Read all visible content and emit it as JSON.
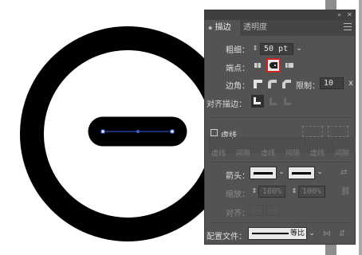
{
  "panel": {
    "tabs": {
      "stroke": "描边",
      "transparency": "透明度"
    },
    "weight": {
      "label": "粗细：",
      "value": "50 pt"
    },
    "cap": {
      "label": "端点："
    },
    "corner": {
      "label": "边角：",
      "limit_label": "限制：",
      "limit_value": "10",
      "limit_unit": "x"
    },
    "align": {
      "label": "对齐描边："
    },
    "dashed": {
      "label": "虚线"
    },
    "dash_cells": [
      "虚线",
      "间隙",
      "虚线",
      "间隙",
      "虚线",
      "间隙"
    ],
    "arrowheads": {
      "label": "箭头："
    },
    "scale": {
      "label": "缩放：",
      "left": "100%",
      "right": "100%"
    },
    "align_arrows": {
      "label": "对齐："
    },
    "profile": {
      "label": "配置文件：",
      "value": "等比"
    }
  },
  "colors": {
    "panel_bg": "#535353",
    "selected_cap_outline": "#cc2222",
    "selection_path": "#3a5bd8"
  }
}
